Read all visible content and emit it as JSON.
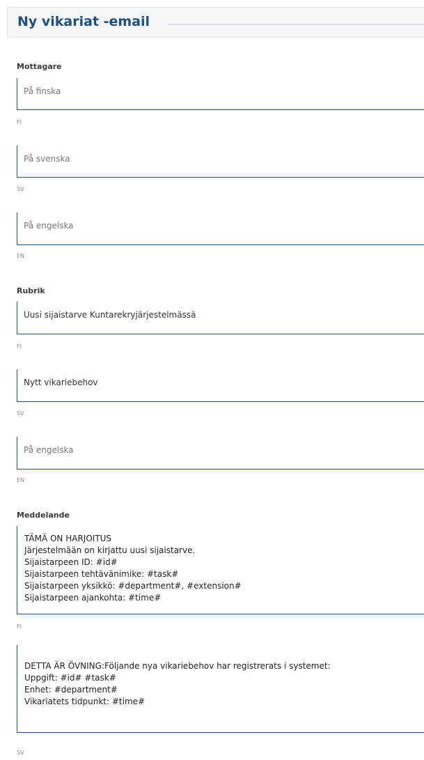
{
  "header": {
    "title": "Ny vikariat -email"
  },
  "recipient": {
    "label": "Mottagare",
    "fields": [
      {
        "placeholder": "På finska",
        "value": "",
        "lang": "FI"
      },
      {
        "placeholder": "På svenska",
        "value": "",
        "lang": "SV"
      },
      {
        "placeholder": "På engelska",
        "value": "",
        "lang": "EN"
      }
    ]
  },
  "subject": {
    "label": "Rubrik",
    "fields": [
      {
        "value": "Uusi sijaistarve Kuntarekryjärjestelmässä",
        "lang": "FI"
      },
      {
        "value": "Nytt vikariebehov",
        "lang": "SV"
      },
      {
        "placeholder": "På engelska",
        "value": "",
        "lang": "EN"
      }
    ]
  },
  "message": {
    "label": "Meddelande",
    "fields": [
      {
        "lines": [
          "TÄMÄ ON HARJOITUS",
          "Järjestelmään on kirjattu uusi sijaistarve.",
          "Sijaistarpeen ID: #id#",
          "Sijaistarpeen tehtävänimike: #task#",
          "Sijaistarpeen yksikkö: #department#, #extension#",
          "Sijaistarpeen ajankohta: #time#"
        ],
        "lang": "FI"
      },
      {
        "lines": [
          "DETTA ÄR ÖVNING:Följande nya vikariebehov har registrerats i systemet:",
          "Uppgift: #id# #task#",
          "Enhet: #department#",
          "Vikariatets tidpunkt: #time#"
        ],
        "lang": "SV"
      }
    ]
  }
}
